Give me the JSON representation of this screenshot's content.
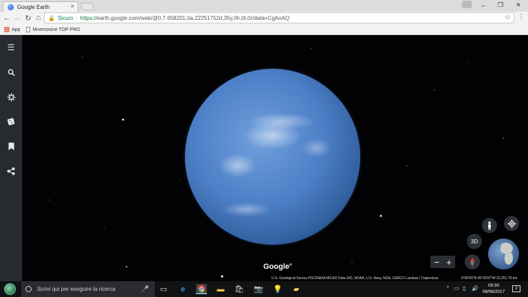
{
  "browser": {
    "tab_title": "Google Earth",
    "tab_close": "×",
    "window_controls": {
      "minimize": "–",
      "maximize": "❐",
      "close": "✕"
    },
    "security_label": "Sicuro",
    "url_protocol": "https://",
    "url_rest": "earth.google.com/web/@0,7.658201,0a,22251752d,35y,0h,0t,0r/data=CgAoAQ",
    "bookmarks": [
      {
        "label": "App",
        "icon": "apps-grid-icon"
      },
      {
        "label": "Mnemosine TOP PRO",
        "icon": "page-icon"
      }
    ]
  },
  "earth": {
    "sidebar_icons": [
      "menu-icon",
      "search-icon",
      "voyager-icon",
      "feeling-lucky-dice-icon",
      "my-places-bookmark-icon",
      "share-icon"
    ],
    "logo": "Google",
    "attribution": "U.S. Geological Survey   PGC/NASA   IBCAO   Data SIO, NOAA, U.S. Navy, NGA, GEBCO   Landsat / Copernicus",
    "coordinates": "0°00'00\"N 95°29'07\"W   22,251.75 km",
    "view_3d_label": "3D",
    "zoom_out": "−",
    "zoom_in": "+"
  },
  "taskbar": {
    "search_placeholder": "Scrivi qui per eseguire la ricerca",
    "time": "09:30",
    "date": "08/06/2017",
    "notification_count": "2"
  }
}
